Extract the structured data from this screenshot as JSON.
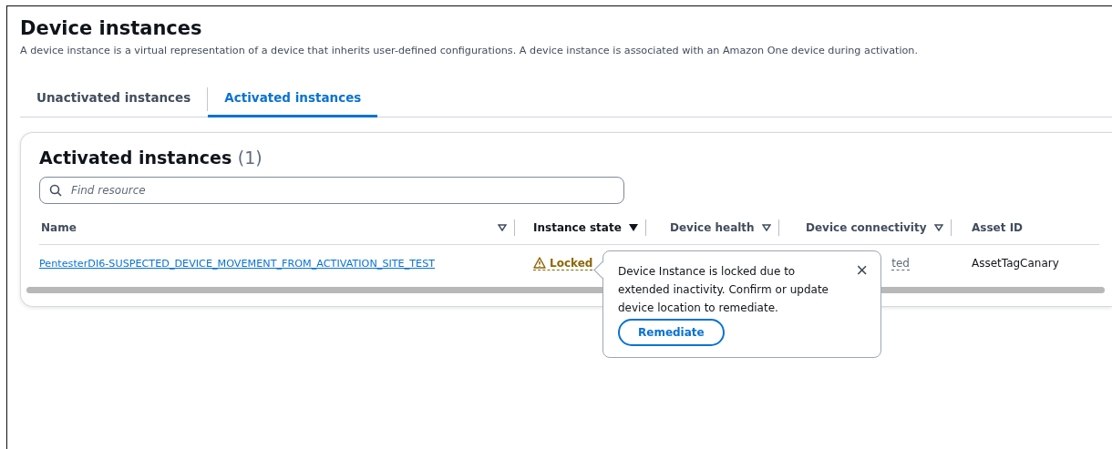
{
  "page": {
    "title": "Device instances",
    "description": "A device instance is a virtual representation of a device that inherits user-defined configurations. A device instance is associated with an Amazon One device during activation."
  },
  "tabs": [
    {
      "label": "Unactivated instances",
      "selected": false
    },
    {
      "label": "Activated instances",
      "selected": true
    }
  ],
  "table": {
    "title": "Activated instances",
    "count": "(1)",
    "search": {
      "placeholder": "Find resource"
    },
    "columns": [
      {
        "label": "Name",
        "sortable": true,
        "sorted": false
      },
      {
        "label": "Instance state",
        "sortable": true,
        "sorted": true
      },
      {
        "label": "Device health",
        "sortable": true,
        "sorted": false
      },
      {
        "label": "Device connectivity",
        "sortable": true,
        "sorted": false
      },
      {
        "label": "Asset ID",
        "sortable": false,
        "sorted": false
      }
    ],
    "rows": [
      {
        "name": "PentesterDI6-SUSPECTED_DEVICE_MOVEMENT_FROM_ACTIVATION_SITE_TEST",
        "instance_state": "Locked",
        "device_connectivity": "ted",
        "asset_id": "AssetTagCanary"
      }
    ]
  },
  "popover": {
    "message": "Device Instance is locked due to extended inactivity. Confirm or update device location to remediate.",
    "close": "×",
    "button": "Remediate"
  }
}
